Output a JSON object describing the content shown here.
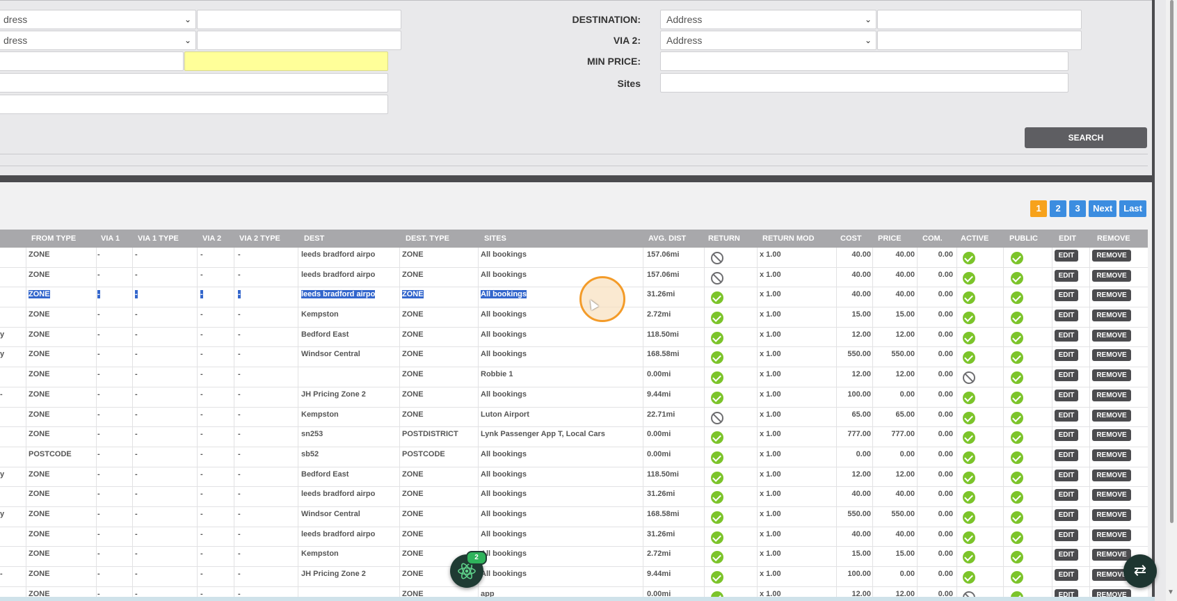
{
  "search": {
    "addr_option": "Address",
    "destination_label": "DESTINATION:",
    "destination_value": "Address",
    "via2_label": "VIA 2:",
    "via2_value": "Address",
    "min_price_label": "MIN PRICE:",
    "sites_label": "Sites",
    "search_button": "SEARCH",
    "left_select_1": "dress",
    "left_select_2": "dress"
  },
  "pagination": {
    "pages": [
      "1",
      "2",
      "3"
    ],
    "next": "Next",
    "last": "Last",
    "current": "1"
  },
  "table": {
    "columns": [
      "FROM TYPE",
      "VIA 1",
      "VIA 1 TYPE",
      "VIA 2",
      "VIA 2 TYPE",
      "DEST",
      "DEST. TYPE",
      "SITES",
      "AVG. DIST",
      "RETURN",
      "RETURN MOD",
      "COST",
      "PRICE",
      "COM.",
      "ACTIVE",
      "PUBLIC",
      "EDIT",
      "REMOVE"
    ],
    "edit_label": "EDIT",
    "remove_label": "REMOVE",
    "rows": [
      {
        "lead": "",
        "from_type": "ZONE",
        "via1": "-",
        "via1_type": "-",
        "via2": "-",
        "via2_type": "-",
        "dest": "leeds bradford airpo",
        "dest_type": "ZONE",
        "sites": "All bookings",
        "avg_dist": "157.06mi",
        "return": false,
        "return_mod": "x 1.00",
        "cost": "40.00",
        "price": "40.00",
        "com": "0.00",
        "active": true,
        "public": true
      },
      {
        "lead": "",
        "from_type": "ZONE",
        "via1": "-",
        "via1_type": "-",
        "via2": "-",
        "via2_type": "-",
        "dest": "leeds bradford airpo",
        "dest_type": "ZONE",
        "sites": "All bookings",
        "avg_dist": "157.06mi",
        "return": false,
        "return_mod": "x 1.00",
        "cost": "40.00",
        "price": "40.00",
        "com": "0.00",
        "active": true,
        "public": true
      },
      {
        "lead": "",
        "from_type": "ZONE",
        "via1": "-",
        "via1_type": "-",
        "via2": "-",
        "via2_type": "-",
        "dest": "leeds bradford airpo",
        "dest_type": "ZONE",
        "sites": "All bookings",
        "avg_dist": "31.26mi",
        "return": true,
        "return_mod": "x 1.00",
        "cost": "40.00",
        "price": "40.00",
        "com": "0.00",
        "active": true,
        "public": true,
        "selected": true
      },
      {
        "lead": "",
        "from_type": "ZONE",
        "via1": "-",
        "via1_type": "-",
        "via2": "-",
        "via2_type": "-",
        "dest": "Kempston",
        "dest_type": "ZONE",
        "sites": "All bookings",
        "avg_dist": "2.72mi",
        "return": true,
        "return_mod": "x 1.00",
        "cost": "15.00",
        "price": "15.00",
        "com": "0.00",
        "active": true,
        "public": true
      },
      {
        "lead": "y",
        "from_type": "ZONE",
        "via1": "-",
        "via1_type": "-",
        "via2": "-",
        "via2_type": "-",
        "dest": "Bedford East",
        "dest_type": "ZONE",
        "sites": "All bookings",
        "avg_dist": "118.50mi",
        "return": true,
        "return_mod": "x 1.00",
        "cost": "12.00",
        "price": "12.00",
        "com": "0.00",
        "active": true,
        "public": true
      },
      {
        "lead": "y",
        "from_type": "ZONE",
        "via1": "-",
        "via1_type": "-",
        "via2": "-",
        "via2_type": "-",
        "dest": "Windsor Central",
        "dest_type": "ZONE",
        "sites": "All bookings",
        "avg_dist": "168.58mi",
        "return": true,
        "return_mod": "x 1.00",
        "cost": "550.00",
        "price": "550.00",
        "com": "0.00",
        "active": true,
        "public": true
      },
      {
        "lead": "",
        "from_type": "ZONE",
        "via1": "-",
        "via1_type": "-",
        "via2": "-",
        "via2_type": "-",
        "dest": "",
        "dest_type": "ZONE",
        "sites": "Robbie 1",
        "avg_dist": "0.00mi",
        "return": true,
        "return_mod": "x 1.00",
        "cost": "12.00",
        "price": "12.00",
        "com": "0.00",
        "active": false,
        "public": true
      },
      {
        "lead": "-",
        "from_type": "ZONE",
        "via1": "-",
        "via1_type": "-",
        "via2": "-",
        "via2_type": "-",
        "dest": "JH Pricing Zone 2",
        "dest_type": "ZONE",
        "sites": "All bookings",
        "avg_dist": "9.44mi",
        "return": true,
        "return_mod": "x 1.00",
        "cost": "100.00",
        "price": "0.00",
        "com": "0.00",
        "active": true,
        "public": true
      },
      {
        "lead": "",
        "from_type": "ZONE",
        "via1": "-",
        "via1_type": "-",
        "via2": "-",
        "via2_type": "-",
        "dest": "Kempston",
        "dest_type": "ZONE",
        "sites": "Luton Airport",
        "avg_dist": "22.71mi",
        "return": false,
        "return_mod": "x 1.00",
        "cost": "65.00",
        "price": "65.00",
        "com": "0.00",
        "active": true,
        "public": true
      },
      {
        "lead": "",
        "from_type": "ZONE",
        "via1": "-",
        "via1_type": "-",
        "via2": "-",
        "via2_type": "-",
        "dest": "sn253",
        "dest_type": "POSTDISTRICT",
        "sites": "Lynk Passenger App T, Local Cars",
        "avg_dist": "0.00mi",
        "return": true,
        "return_mod": "x 1.00",
        "cost": "777.00",
        "price": "777.00",
        "com": "0.00",
        "active": true,
        "public": true
      },
      {
        "lead": "",
        "from_type": "POSTCODE",
        "via1": "-",
        "via1_type": "-",
        "via2": "-",
        "via2_type": "-",
        "dest": "sb52",
        "dest_type": "POSTCODE",
        "sites": "All bookings",
        "avg_dist": "0.00mi",
        "return": true,
        "return_mod": "x 1.00",
        "cost": "0.00",
        "price": "0.00",
        "com": "0.00",
        "active": true,
        "public": true
      },
      {
        "lead": "y",
        "from_type": "ZONE",
        "via1": "-",
        "via1_type": "-",
        "via2": "-",
        "via2_type": "-",
        "dest": "Bedford East",
        "dest_type": "ZONE",
        "sites": "All bookings",
        "avg_dist": "118.50mi",
        "return": true,
        "return_mod": "x 1.00",
        "cost": "12.00",
        "price": "12.00",
        "com": "0.00",
        "active": true,
        "public": true
      },
      {
        "lead": "",
        "from_type": "ZONE",
        "via1": "-",
        "via1_type": "-",
        "via2": "-",
        "via2_type": "-",
        "dest": "leeds bradford airpo",
        "dest_type": "ZONE",
        "sites": "All bookings",
        "avg_dist": "31.26mi",
        "return": true,
        "return_mod": "x 1.00",
        "cost": "40.00",
        "price": "40.00",
        "com": "0.00",
        "active": true,
        "public": true
      },
      {
        "lead": "y",
        "from_type": "ZONE",
        "via1": "-",
        "via1_type": "-",
        "via2": "-",
        "via2_type": "-",
        "dest": "Windsor Central",
        "dest_type": "ZONE",
        "sites": "All bookings",
        "avg_dist": "168.58mi",
        "return": true,
        "return_mod": "x 1.00",
        "cost": "550.00",
        "price": "550.00",
        "com": "0.00",
        "active": true,
        "public": true
      },
      {
        "lead": "",
        "from_type": "ZONE",
        "via1": "-",
        "via1_type": "-",
        "via2": "-",
        "via2_type": "-",
        "dest": "leeds bradford airpo",
        "dest_type": "ZONE",
        "sites": "All bookings",
        "avg_dist": "31.26mi",
        "return": true,
        "return_mod": "x 1.00",
        "cost": "40.00",
        "price": "40.00",
        "com": "0.00",
        "active": true,
        "public": true
      },
      {
        "lead": "",
        "from_type": "ZONE",
        "via1": "-",
        "via1_type": "-",
        "via2": "-",
        "via2_type": "-",
        "dest": "Kempston",
        "dest_type": "ZONE",
        "sites": "All bookings",
        "avg_dist": "2.72mi",
        "return": true,
        "return_mod": "x 1.00",
        "cost": "15.00",
        "price": "15.00",
        "com": "0.00",
        "active": true,
        "public": true
      },
      {
        "lead": "-",
        "from_type": "ZONE",
        "via1": "-",
        "via1_type": "-",
        "via2": "-",
        "via2_type": "-",
        "dest": "JH Pricing Zone 2",
        "dest_type": "ZONE",
        "sites": "All bookings",
        "avg_dist": "9.44mi",
        "return": true,
        "return_mod": "x 1.00",
        "cost": "100.00",
        "price": "0.00",
        "com": "0.00",
        "active": true,
        "public": true
      },
      {
        "lead": "",
        "from_type": "ZONE",
        "via1": "-",
        "via1_type": "-",
        "via2": "-",
        "via2_type": "-",
        "dest": "",
        "dest_type": "ZONE",
        "sites": "app",
        "avg_dist": "0.00mi",
        "return": true,
        "return_mod": "x 1.00",
        "cost": "12.00",
        "price": "12.00",
        "com": "0.00",
        "active": false,
        "public": true
      }
    ]
  },
  "overlays": {
    "atom_badge": "2",
    "swap_icon": "⇄"
  },
  "colors": {
    "accent": "#3c8de0",
    "active_page": "#f7a21b",
    "ok": "#7cc42a",
    "header": "#a8a8ab",
    "button": "#4c4c4f"
  }
}
